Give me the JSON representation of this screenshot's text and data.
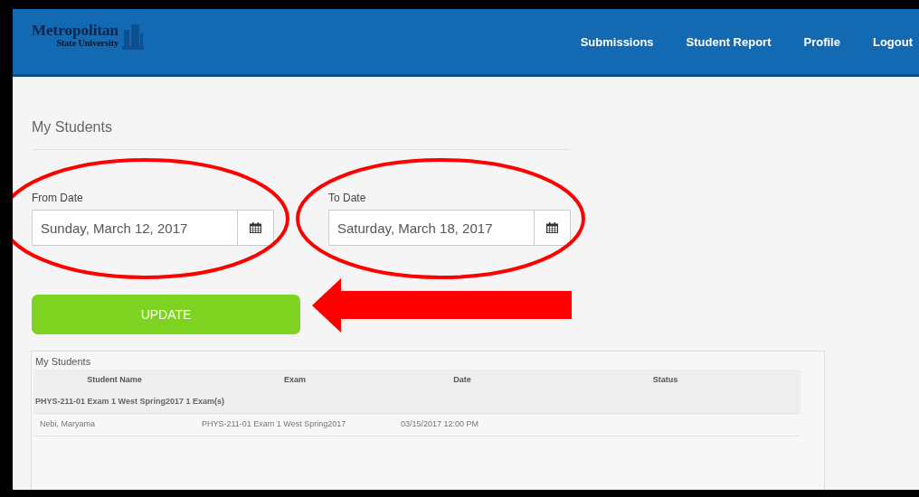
{
  "logo": {
    "name": "Metropolitan",
    "subtitle": "State University"
  },
  "nav_links": [
    "Submissions",
    "Student Report",
    "Profile",
    "Logout"
  ],
  "page_title": "My Students",
  "date_fields": [
    {
      "label": "From Date",
      "value": "Sunday, March 12, 2017"
    },
    {
      "label": "To Date",
      "value": "Saturday, March 18, 2017"
    }
  ],
  "update_button": "UPDATE",
  "panel": {
    "title": "My Students",
    "table": {
      "columns": [
        "Student Name",
        "Exam",
        "Date",
        "Status"
      ],
      "groups": [
        {
          "title": "PHYS-211-01 Exam 1 West Spring2017 1 Exam(s)",
          "rows": [
            {
              "student_name": "Nebi, Maryama",
              "exam": "PHYS-211-01 Exam 1 West Spring2017",
              "date": "03/15/2017 12:00 PM"
            }
          ]
        }
      ]
    }
  }
}
